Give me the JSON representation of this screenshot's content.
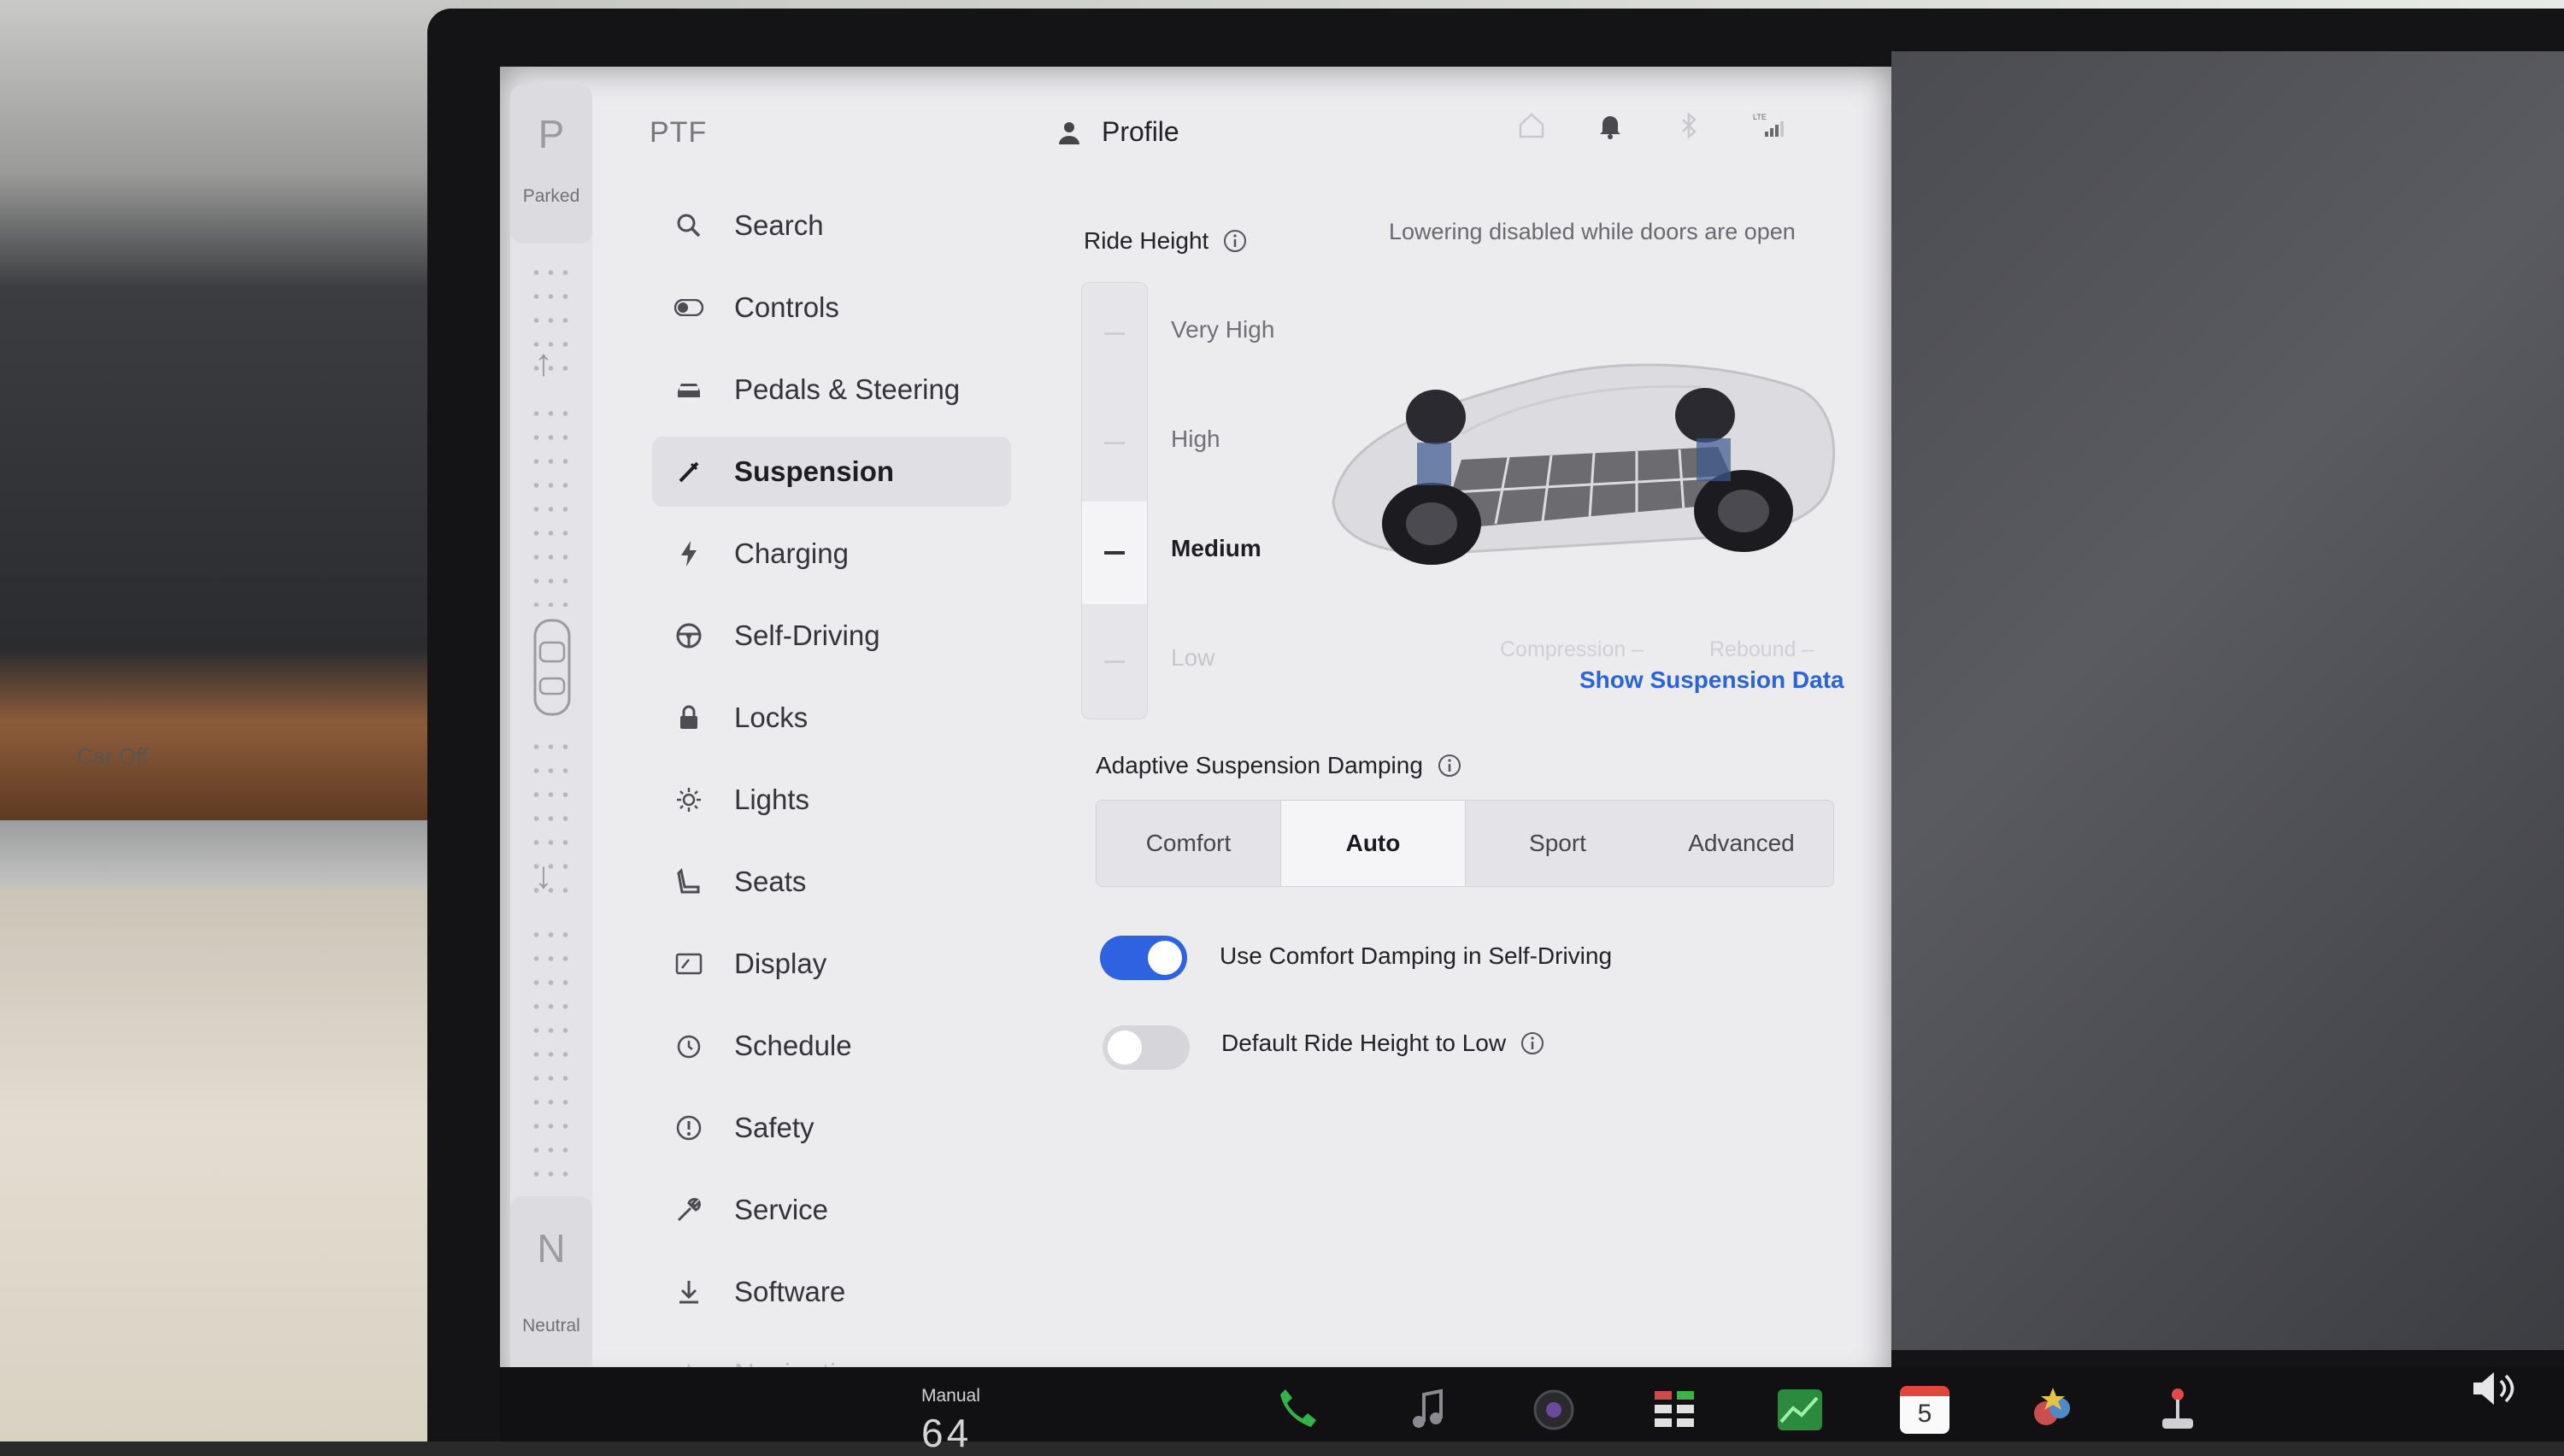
{
  "drive": {
    "gear_top_letter": "P",
    "gear_top_label": "Parked",
    "gear_bottom_letter": "N",
    "gear_bottom_label": "Neutral"
  },
  "environment": {
    "dash_text": "Car Off"
  },
  "header": {
    "brand": "PTF",
    "profile_label": "Profile",
    "status_icons": [
      "home-icon",
      "bell-icon",
      "bluetooth-icon",
      "lte-signal-icon"
    ]
  },
  "nav": {
    "items": [
      {
        "label": "Search",
        "icon": "search-icon"
      },
      {
        "label": "Controls",
        "icon": "toggle-icon"
      },
      {
        "label": "Pedals & Steering",
        "icon": "car-icon"
      },
      {
        "label": "Suspension",
        "icon": "suspension-icon",
        "active": true
      },
      {
        "label": "Charging",
        "icon": "bolt-icon"
      },
      {
        "label": "Self-Driving",
        "icon": "steering-wheel-icon"
      },
      {
        "label": "Locks",
        "icon": "lock-icon"
      },
      {
        "label": "Lights",
        "icon": "sun-icon"
      },
      {
        "label": "Seats",
        "icon": "seat-icon"
      },
      {
        "label": "Display",
        "icon": "display-icon"
      },
      {
        "label": "Schedule",
        "icon": "clock-icon"
      },
      {
        "label": "Safety",
        "icon": "alert-icon"
      },
      {
        "label": "Service",
        "icon": "wrench-icon"
      },
      {
        "label": "Software",
        "icon": "download-icon"
      },
      {
        "label": "Navigation",
        "icon": "navigation-icon",
        "faded": true
      }
    ]
  },
  "ride_height": {
    "title": "Ride Height",
    "note": "Lowering disabled while doors are open",
    "levels": [
      "Very High",
      "High",
      "Medium",
      "Low"
    ],
    "selected": "Medium",
    "compression_label": "Compression",
    "compression_value": "–",
    "rebound_label": "Rebound",
    "rebound_value": "–",
    "show_data_link": "Show Suspension Data"
  },
  "damping": {
    "title": "Adaptive Suspension Damping",
    "options": [
      "Comfort",
      "Auto",
      "Sport",
      "Advanced"
    ],
    "selected": "Auto"
  },
  "toggles": {
    "comfort_damping_label": "Use Comfort Damping in Self-Driving",
    "comfort_damping_on": true,
    "default_low_label": "Default Ride Height to Low",
    "default_low_on": false
  },
  "taskbar": {
    "manual_label": "Manual",
    "speed_readout": "64",
    "calendar_day": "5",
    "icons": [
      "phone-icon",
      "music-icon",
      "camera-icon",
      "apps-icon",
      "stocks-icon",
      "calendar-icon",
      "toybox-icon",
      "joystick-icon",
      "volume-icon"
    ]
  },
  "colors": {
    "accent": "#2f62e0",
    "link": "#2b64d8",
    "screen_bg": "#ecebee"
  }
}
